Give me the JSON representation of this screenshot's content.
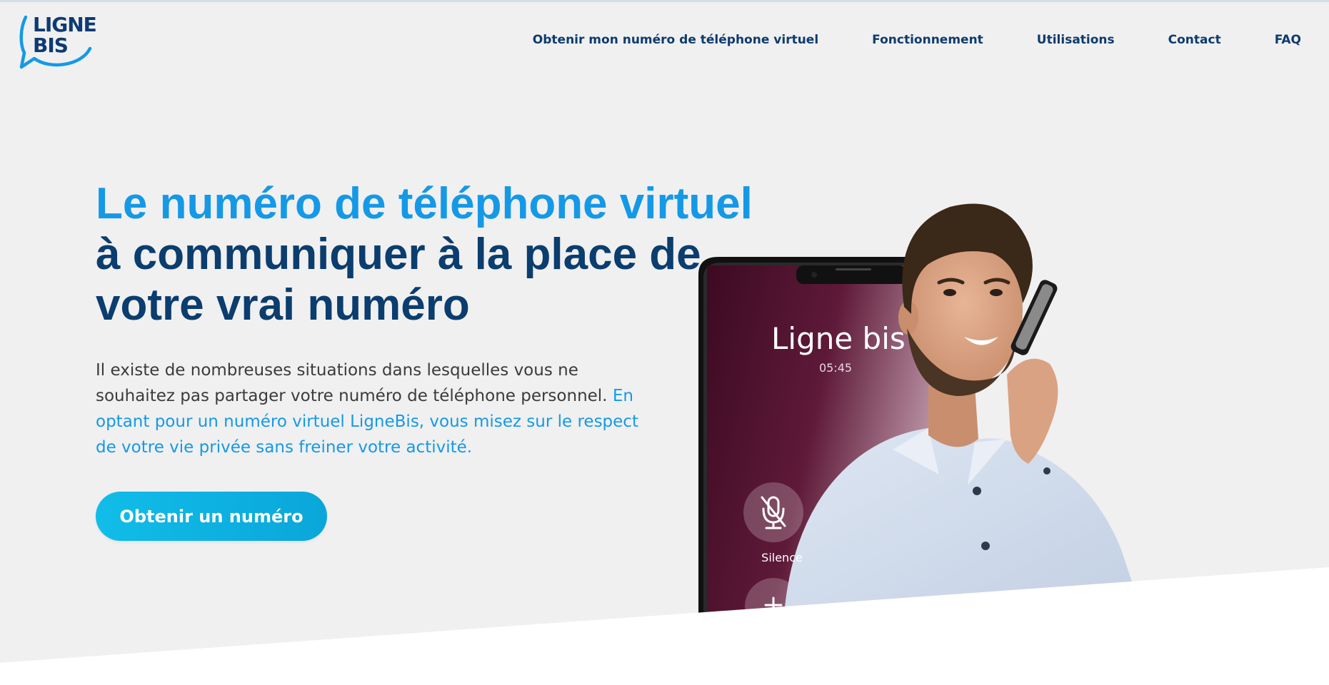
{
  "header": {
    "logo_lines": [
      "LIGNE",
      "BIS"
    ],
    "nav": [
      {
        "label": "Obtenir mon numéro de téléphone virtuel"
      },
      {
        "label": "Fonctionnement"
      },
      {
        "label": "Utilisations"
      },
      {
        "label": "Contact"
      },
      {
        "label": "FAQ"
      }
    ]
  },
  "hero": {
    "headline_accent": "Le numéro de téléphone virtuel",
    "headline_dark": "à communiquer à la place de votre vrai numéro",
    "intro_dark": "Il existe de nombreuses situations dans lesquelles vous ne souhaitez pas partager votre numéro de téléphone personnel.",
    "intro_accent": "En optant pour un numéro virtuel LigneBis, vous misez sur le respect de votre vie privée sans freiner votre activité.",
    "cta_label": "Obtenir un numéro"
  },
  "phone_screen": {
    "caller_name": "Ligne bis",
    "call_timer": "05:45",
    "mute_label": "Silence",
    "icons": [
      "mute-microphone-icon",
      "add-call-icon"
    ]
  },
  "colors": {
    "hero_background": "#f0f0f0",
    "accent_blue": "#1599e6",
    "dark_blue": "#0b3d6e",
    "cta_gradient_start": "#11bde8",
    "cta_gradient_end": "#0aa6da",
    "body_text": "#3b3b3b"
  }
}
